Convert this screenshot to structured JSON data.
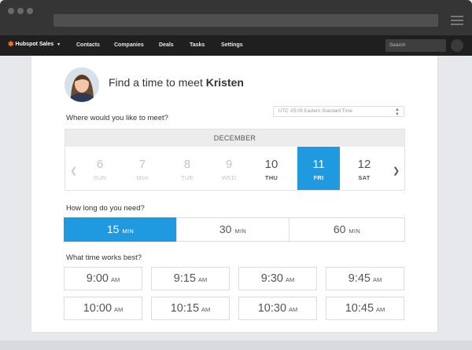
{
  "navbar": {
    "brand": "Hubspot Sales",
    "links": [
      "Contacts",
      "Companies",
      "Deals",
      "Tasks",
      "Settings"
    ],
    "search_placeholder": "Search"
  },
  "meeting": {
    "title_prefix": "Find a time to meet",
    "host_name": "Kristen",
    "timezone": "UTC -05:00 Eastern Standard Time",
    "where_label": "Where would you like to meet?",
    "calendar": {
      "month": "DECEMBER",
      "days": [
        {
          "num": "6",
          "dow": "SUN"
        },
        {
          "num": "7",
          "dow": "Mon"
        },
        {
          "num": "8",
          "dow": "TUE"
        },
        {
          "num": "9",
          "dow": "WED"
        },
        {
          "num": "10",
          "dow": "THU"
        },
        {
          "num": "11",
          "dow": "FRI"
        },
        {
          "num": "12",
          "dow": "SAT"
        }
      ],
      "selected_day": "11"
    },
    "duration_label": "How long do you need?",
    "durations": [
      {
        "value": "15",
        "unit": "MIN"
      },
      {
        "value": "30",
        "unit": "MIN"
      },
      {
        "value": "60",
        "unit": "MIN"
      }
    ],
    "selected_duration": "15",
    "time_label": "What time works best?",
    "slots": [
      {
        "time": "9:00",
        "ap": "AM"
      },
      {
        "time": "9:15",
        "ap": "AM"
      },
      {
        "time": "9:30",
        "ap": "AM"
      },
      {
        "time": "9:45",
        "ap": "AM"
      },
      {
        "time": "10:00",
        "ap": "AM"
      },
      {
        "time": "10:15",
        "ap": "AM"
      },
      {
        "time": "10:30",
        "ap": "AM"
      },
      {
        "time": "10:45",
        "ap": "AM"
      }
    ]
  },
  "colors": {
    "accent": "#1f9ae0",
    "nav_bg": "#1f1f1f",
    "chrome_bg": "#353535",
    "brand_logo": "#f57722"
  }
}
